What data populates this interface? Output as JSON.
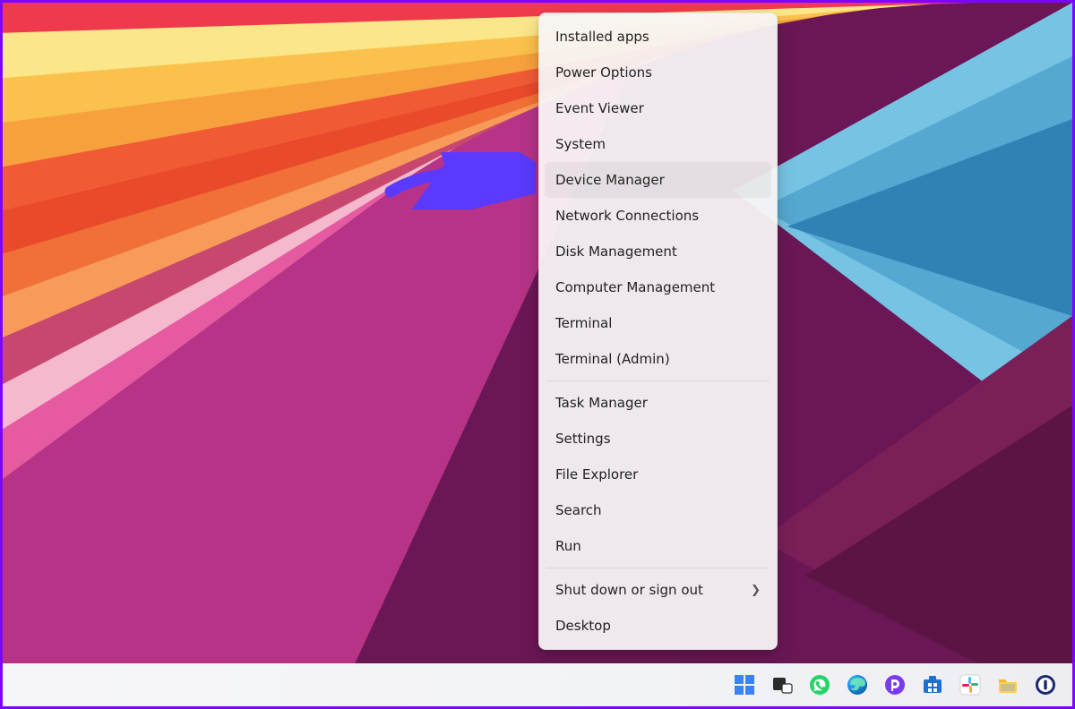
{
  "menu": {
    "groups": [
      [
        {
          "label": "Installed apps",
          "highlighted": false
        },
        {
          "label": "Power Options",
          "highlighted": false
        },
        {
          "label": "Event Viewer",
          "highlighted": false
        },
        {
          "label": "System",
          "highlighted": false
        },
        {
          "label": "Device Manager",
          "highlighted": true
        },
        {
          "label": "Network Connections",
          "highlighted": false
        },
        {
          "label": "Disk Management",
          "highlighted": false
        },
        {
          "label": "Computer Management",
          "highlighted": false
        },
        {
          "label": "Terminal",
          "highlighted": false
        },
        {
          "label": "Terminal (Admin)",
          "highlighted": false
        }
      ],
      [
        {
          "label": "Task Manager",
          "highlighted": false
        },
        {
          "label": "Settings",
          "highlighted": false
        },
        {
          "label": "File Explorer",
          "highlighted": false
        },
        {
          "label": "Search",
          "highlighted": false
        },
        {
          "label": "Run",
          "highlighted": false
        }
      ],
      [
        {
          "label": "Shut down or sign out",
          "highlighted": false,
          "submenu": true
        },
        {
          "label": "Desktop",
          "highlighted": false
        }
      ]
    ]
  },
  "taskbar": {
    "icons": [
      {
        "name": "start"
      },
      {
        "name": "taskview"
      },
      {
        "name": "whatsapp"
      },
      {
        "name": "edge"
      },
      {
        "name": "purpleapp"
      },
      {
        "name": "store"
      },
      {
        "name": "slack"
      },
      {
        "name": "explorer"
      },
      {
        "name": "onepass"
      }
    ]
  },
  "annotation": {
    "arrow_color": "#5a3aff"
  }
}
